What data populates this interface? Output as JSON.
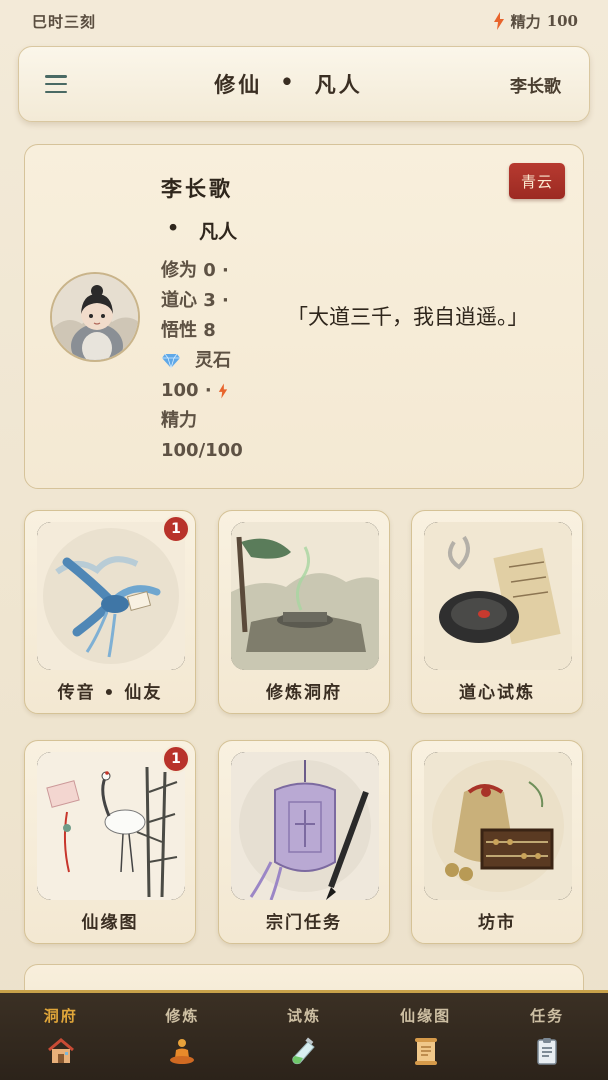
{
  "status": {
    "time": "巳时三刻",
    "energy_label": "精力",
    "energy_value": "100"
  },
  "header": {
    "title_a": "修仙",
    "title_sep": "•",
    "title_b": "凡人",
    "username": "李长歌"
  },
  "profile": {
    "name": "李长歌",
    "realm_sep": "•",
    "realm": "凡人",
    "line1": "修为 0 ·",
    "line2": "道心 3 ·",
    "line3": "悟性 8",
    "line4": "灵石",
    "line5": "100 ·",
    "line6": "精力",
    "line7": "100/100",
    "motto": "「大道三千，我自逍遥。」",
    "sect": "青云"
  },
  "tiles": [
    {
      "label": "传音 • 仙友",
      "badge": "1"
    },
    {
      "label": "修炼洞府",
      "badge": ""
    },
    {
      "label": "道心试炼",
      "badge": ""
    },
    {
      "label": "仙缘图",
      "badge": "1"
    },
    {
      "label": "宗门任务",
      "badge": ""
    },
    {
      "label": "坊市",
      "badge": ""
    }
  ],
  "nav": [
    {
      "label": "洞府",
      "icon": "house-icon",
      "active": true
    },
    {
      "label": "修炼",
      "icon": "meditation-icon",
      "active": false
    },
    {
      "label": "试炼",
      "icon": "potion-icon",
      "active": false
    },
    {
      "label": "仙缘图",
      "icon": "scroll-icon",
      "active": false
    },
    {
      "label": "任务",
      "icon": "clipboard-icon",
      "active": false
    }
  ],
  "colors": {
    "accent": "#c8a24a",
    "nav_active": "#e0a63a",
    "badge": "#b8322a",
    "sect_badge": "#a93027"
  }
}
